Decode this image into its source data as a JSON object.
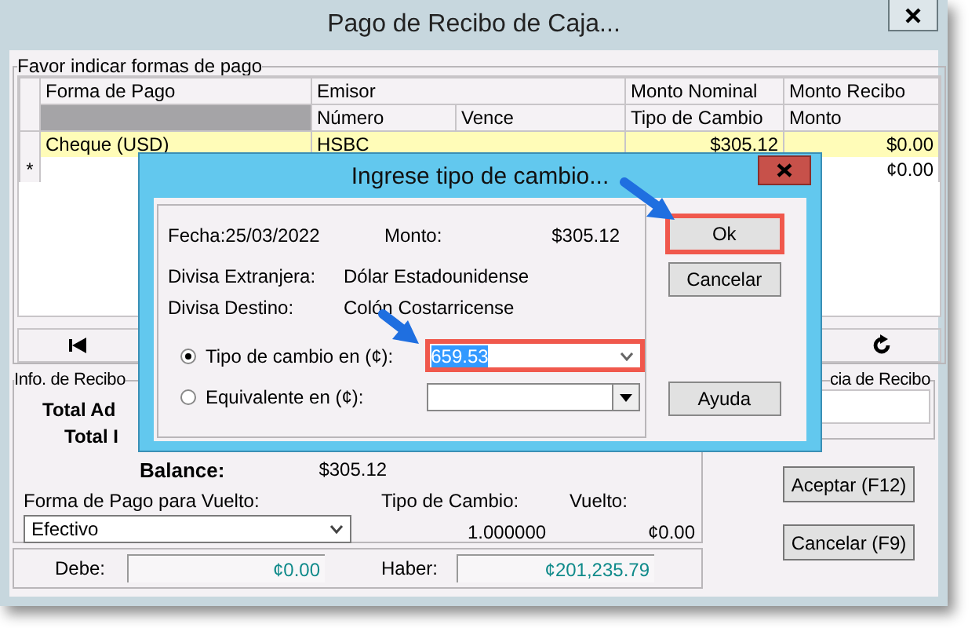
{
  "window": {
    "title": "Pago de Recibo de Caja..."
  },
  "payments": {
    "title": "Favor indicar formas de pago",
    "header_top": [
      "Forma de Pago",
      "Emisor",
      "Monto Nominal",
      "Monto Recibo"
    ],
    "header_sub": [
      "Número",
      "Vence",
      "Tipo de Cambio",
      "Monto"
    ],
    "rows": [
      {
        "forma": "Cheque (USD)",
        "emisor": "HSBC",
        "monto_nominal": "$305.12",
        "monto_recibo": "$0.00",
        "selected": true
      },
      {
        "marker": "*",
        "monto_recibo": "¢0.00",
        "selected": false
      }
    ]
  },
  "info": {
    "title": "Info. de Recibo",
    "lines": [
      "Total Ad",
      "Total I"
    ],
    "balance_label": "Balance:",
    "balance_value": "$305.12"
  },
  "reference": {
    "title": "cia de Recibo"
  },
  "vuelto": {
    "label": "Forma de Pago para Vuelto:",
    "value": "Efectivo",
    "rate_label": "Tipo de Cambio:",
    "rate": "1.000000",
    "change_label": "Vuelto:",
    "change": "¢0.00"
  },
  "totals": {
    "debe_label": "Debe:",
    "debe": "¢0.00",
    "haber_label": "Haber:",
    "haber": "¢201,235.79"
  },
  "buttons": [
    "Aceptar (F12)",
    "Cancelar (F9)"
  ],
  "dialog": {
    "title": "Ingrese tipo de cambio...",
    "fecha": "Fecha:25/03/2022",
    "monto_label": "Monto:",
    "monto": "$305.12",
    "info": [
      {
        "label": "Divisa Extranjera:",
        "value": "Dólar Estadounidense"
      },
      {
        "label": "Divisa Destino:",
        "value": "Colón Costarricense"
      }
    ],
    "options": [
      {
        "label": "Tipo de cambio en (¢):",
        "selected": true,
        "value": "659.53"
      },
      {
        "label": "Equivalente en (¢):",
        "selected": false
      }
    ],
    "buttons": [
      {
        "label": "Ok",
        "highlighted": true
      },
      {
        "label": "Cancelar",
        "highlighted": false
      },
      {
        "label": "Ayuda",
        "highlighted": false
      }
    ]
  }
}
